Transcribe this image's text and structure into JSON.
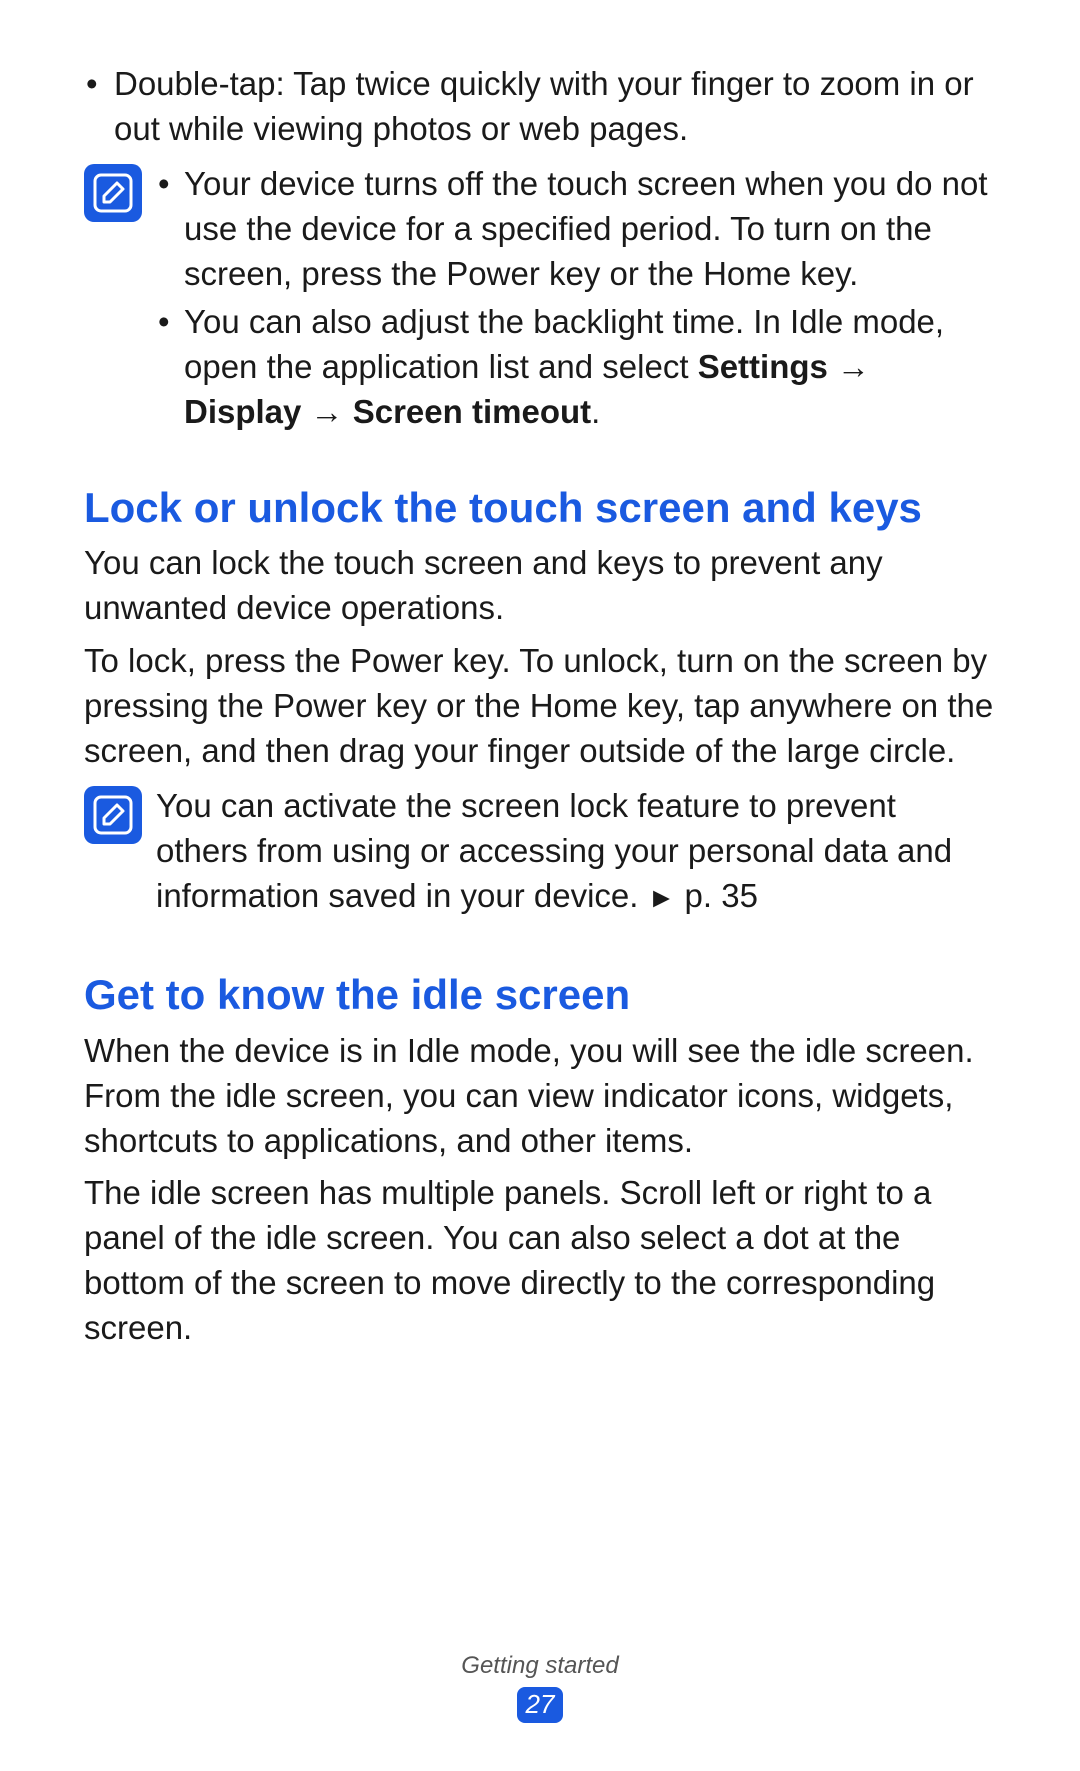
{
  "top_bullets": [
    "Double-tap: Tap twice quickly with your finger to zoom in or out while viewing photos or web pages."
  ],
  "note1": {
    "items": [
      {
        "plain": "Your device turns off the touch screen when you do not use the device for a specified period. To turn on the screen, press the Power key or the Home key."
      },
      {
        "prefix": "You can also adjust the backlight time. In Idle mode, open the application list and select ",
        "bold_path": "Settings → Display → Screen timeout",
        "suffix": "."
      }
    ]
  },
  "section1": {
    "title": "Lock or unlock the touch screen and keys",
    "p1": "You can lock the touch screen and keys to prevent any unwanted device operations.",
    "p2": "To lock, press the Power key. To unlock, turn on the screen by pressing the Power key or the Home key, tap anywhere on the screen, and then drag your finger outside of the large circle."
  },
  "note2": {
    "text_prefix": "You can activate the screen lock feature to prevent others from using or accessing your personal data and information saved in your device. ",
    "ref_arrow": "►",
    "ref_text": " p. 35"
  },
  "section2": {
    "title": "Get to know the idle screen",
    "p1": "When the device is in Idle mode, you will see the idle screen. From the idle screen, you can view indicator icons, widgets, shortcuts to applications, and other items.",
    "p2": "The idle screen has multiple panels. Scroll left or right to a panel of the idle screen. You can also select a dot at the bottom of the screen to move directly to the corresponding screen."
  },
  "footer": {
    "section": "Getting started",
    "page": "27"
  },
  "bullet_char": "•"
}
